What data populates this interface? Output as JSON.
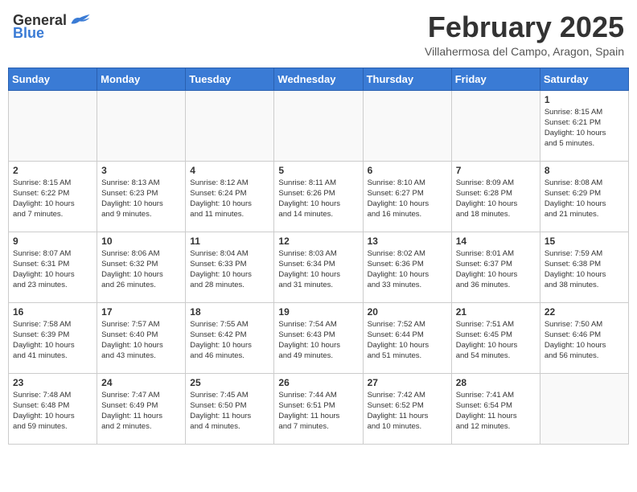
{
  "header": {
    "logo_general": "General",
    "logo_blue": "Blue",
    "title": "February 2025",
    "subtitle": "Villahermosa del Campo, Aragon, Spain"
  },
  "weekdays": [
    "Sunday",
    "Monday",
    "Tuesday",
    "Wednesday",
    "Thursday",
    "Friday",
    "Saturday"
  ],
  "weeks": [
    [
      {
        "day": "",
        "info": ""
      },
      {
        "day": "",
        "info": ""
      },
      {
        "day": "",
        "info": ""
      },
      {
        "day": "",
        "info": ""
      },
      {
        "day": "",
        "info": ""
      },
      {
        "day": "",
        "info": ""
      },
      {
        "day": "1",
        "info": "Sunrise: 8:15 AM\nSunset: 6:21 PM\nDaylight: 10 hours\nand 5 minutes."
      }
    ],
    [
      {
        "day": "2",
        "info": "Sunrise: 8:15 AM\nSunset: 6:22 PM\nDaylight: 10 hours\nand 7 minutes."
      },
      {
        "day": "3",
        "info": "Sunrise: 8:13 AM\nSunset: 6:23 PM\nDaylight: 10 hours\nand 9 minutes."
      },
      {
        "day": "4",
        "info": "Sunrise: 8:12 AM\nSunset: 6:24 PM\nDaylight: 10 hours\nand 11 minutes."
      },
      {
        "day": "5",
        "info": "Sunrise: 8:11 AM\nSunset: 6:26 PM\nDaylight: 10 hours\nand 14 minutes."
      },
      {
        "day": "6",
        "info": "Sunrise: 8:10 AM\nSunset: 6:27 PM\nDaylight: 10 hours\nand 16 minutes."
      },
      {
        "day": "7",
        "info": "Sunrise: 8:09 AM\nSunset: 6:28 PM\nDaylight: 10 hours\nand 18 minutes."
      },
      {
        "day": "8",
        "info": "Sunrise: 8:08 AM\nSunset: 6:29 PM\nDaylight: 10 hours\nand 21 minutes."
      }
    ],
    [
      {
        "day": "9",
        "info": "Sunrise: 8:07 AM\nSunset: 6:31 PM\nDaylight: 10 hours\nand 23 minutes."
      },
      {
        "day": "10",
        "info": "Sunrise: 8:06 AM\nSunset: 6:32 PM\nDaylight: 10 hours\nand 26 minutes."
      },
      {
        "day": "11",
        "info": "Sunrise: 8:04 AM\nSunset: 6:33 PM\nDaylight: 10 hours\nand 28 minutes."
      },
      {
        "day": "12",
        "info": "Sunrise: 8:03 AM\nSunset: 6:34 PM\nDaylight: 10 hours\nand 31 minutes."
      },
      {
        "day": "13",
        "info": "Sunrise: 8:02 AM\nSunset: 6:36 PM\nDaylight: 10 hours\nand 33 minutes."
      },
      {
        "day": "14",
        "info": "Sunrise: 8:01 AM\nSunset: 6:37 PM\nDaylight: 10 hours\nand 36 minutes."
      },
      {
        "day": "15",
        "info": "Sunrise: 7:59 AM\nSunset: 6:38 PM\nDaylight: 10 hours\nand 38 minutes."
      }
    ],
    [
      {
        "day": "16",
        "info": "Sunrise: 7:58 AM\nSunset: 6:39 PM\nDaylight: 10 hours\nand 41 minutes."
      },
      {
        "day": "17",
        "info": "Sunrise: 7:57 AM\nSunset: 6:40 PM\nDaylight: 10 hours\nand 43 minutes."
      },
      {
        "day": "18",
        "info": "Sunrise: 7:55 AM\nSunset: 6:42 PM\nDaylight: 10 hours\nand 46 minutes."
      },
      {
        "day": "19",
        "info": "Sunrise: 7:54 AM\nSunset: 6:43 PM\nDaylight: 10 hours\nand 49 minutes."
      },
      {
        "day": "20",
        "info": "Sunrise: 7:52 AM\nSunset: 6:44 PM\nDaylight: 10 hours\nand 51 minutes."
      },
      {
        "day": "21",
        "info": "Sunrise: 7:51 AM\nSunset: 6:45 PM\nDaylight: 10 hours\nand 54 minutes."
      },
      {
        "day": "22",
        "info": "Sunrise: 7:50 AM\nSunset: 6:46 PM\nDaylight: 10 hours\nand 56 minutes."
      }
    ],
    [
      {
        "day": "23",
        "info": "Sunrise: 7:48 AM\nSunset: 6:48 PM\nDaylight: 10 hours\nand 59 minutes."
      },
      {
        "day": "24",
        "info": "Sunrise: 7:47 AM\nSunset: 6:49 PM\nDaylight: 11 hours\nand 2 minutes."
      },
      {
        "day": "25",
        "info": "Sunrise: 7:45 AM\nSunset: 6:50 PM\nDaylight: 11 hours\nand 4 minutes."
      },
      {
        "day": "26",
        "info": "Sunrise: 7:44 AM\nSunset: 6:51 PM\nDaylight: 11 hours\nand 7 minutes."
      },
      {
        "day": "27",
        "info": "Sunrise: 7:42 AM\nSunset: 6:52 PM\nDaylight: 11 hours\nand 10 minutes."
      },
      {
        "day": "28",
        "info": "Sunrise: 7:41 AM\nSunset: 6:54 PM\nDaylight: 11 hours\nand 12 minutes."
      },
      {
        "day": "",
        "info": ""
      }
    ]
  ]
}
